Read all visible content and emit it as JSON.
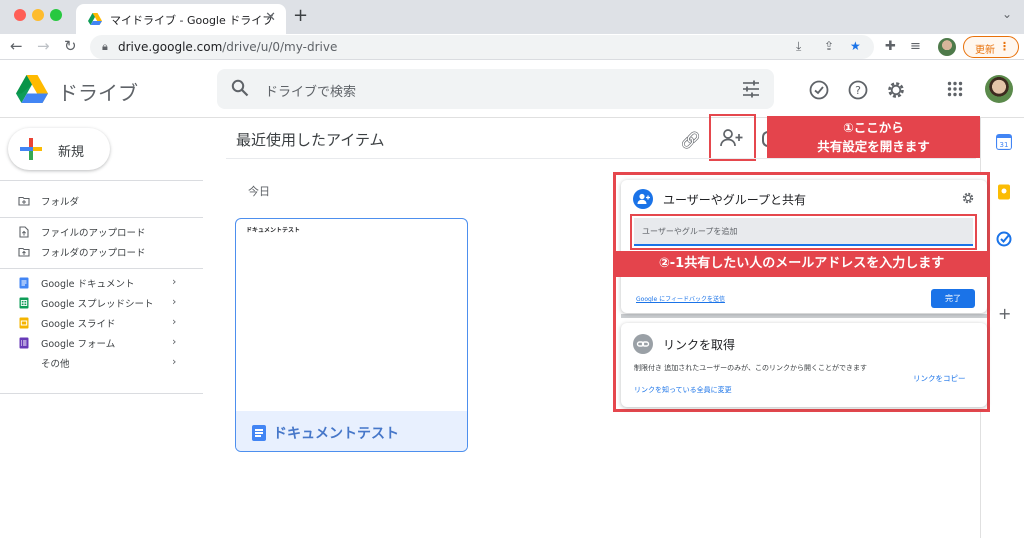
{
  "browser": {
    "tab_title": "マイドライブ - Google ドライブ",
    "tab_close": "✕",
    "new_tab": "+",
    "url_host": "drive.google.com",
    "url_path": "/drive/u/0/my-drive",
    "update_label": "更新"
  },
  "header": {
    "brand": "ドライブ",
    "search_placeholder": "ドライブで検索"
  },
  "sidebar": {
    "new_label": "新規",
    "items": [
      {
        "label": "フォルダ"
      },
      {
        "label": "ファイルのアップロード"
      },
      {
        "label": "フォルダのアップロード"
      },
      {
        "label": "Google ドキュメント"
      },
      {
        "label": "Google スプレッドシート"
      },
      {
        "label": "Google スライド"
      },
      {
        "label": "Google フォーム"
      },
      {
        "label": "その他"
      }
    ]
  },
  "main": {
    "title": "最近使用したアイテム",
    "today": "今日",
    "doc_preview_title": "ドキュメントテスト",
    "doc_name": "ドキュメントテスト"
  },
  "callouts": {
    "one_line1": "①ここから",
    "one_line2": "共有設定を開きます",
    "two": "②-1共有したい人のメールアドレスを入力します"
  },
  "share_dialog": {
    "title": "ユーザーやグループと共有",
    "input_placeholder": "ユーザーやグループを追加",
    "feedback": "Google にフィードバックを送信",
    "done": "完了"
  },
  "link_panel": {
    "title": "リンクを取得",
    "description": "制限付き 追加されたユーザーのみが、このリンクから開くことができます",
    "change": "リンクを知っている全員に変更",
    "copy": "リンクをコピー"
  },
  "colors": {
    "accent_blue": "#1a73e8",
    "callout_red": "#e4444c",
    "update_orange": "#e8710a"
  }
}
